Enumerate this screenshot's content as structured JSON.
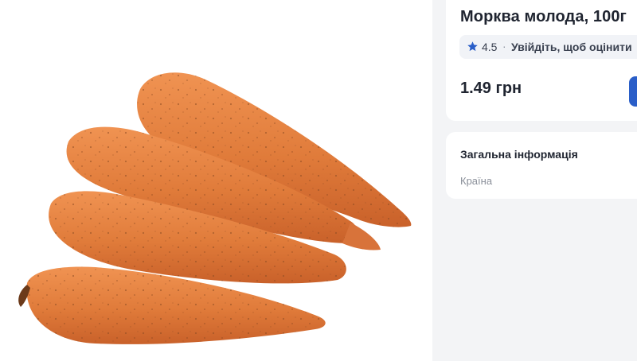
{
  "product": {
    "image_alt": "carrots-photo",
    "title": "Морква молода, 100г",
    "rating": {
      "value": "4.5",
      "separator": "·",
      "login_prompt": "Увійдіть, щоб оцінити"
    },
    "price": "1.49 грн"
  },
  "general_info": {
    "heading": "Загальна інформація",
    "country_label": "Країна"
  },
  "colors": {
    "accent": "#2a5ec8",
    "page_background": "#f3f4f6",
    "card_background": "#ffffff"
  },
  "icons": {
    "rating": "star-icon",
    "cart": "cart-button"
  }
}
